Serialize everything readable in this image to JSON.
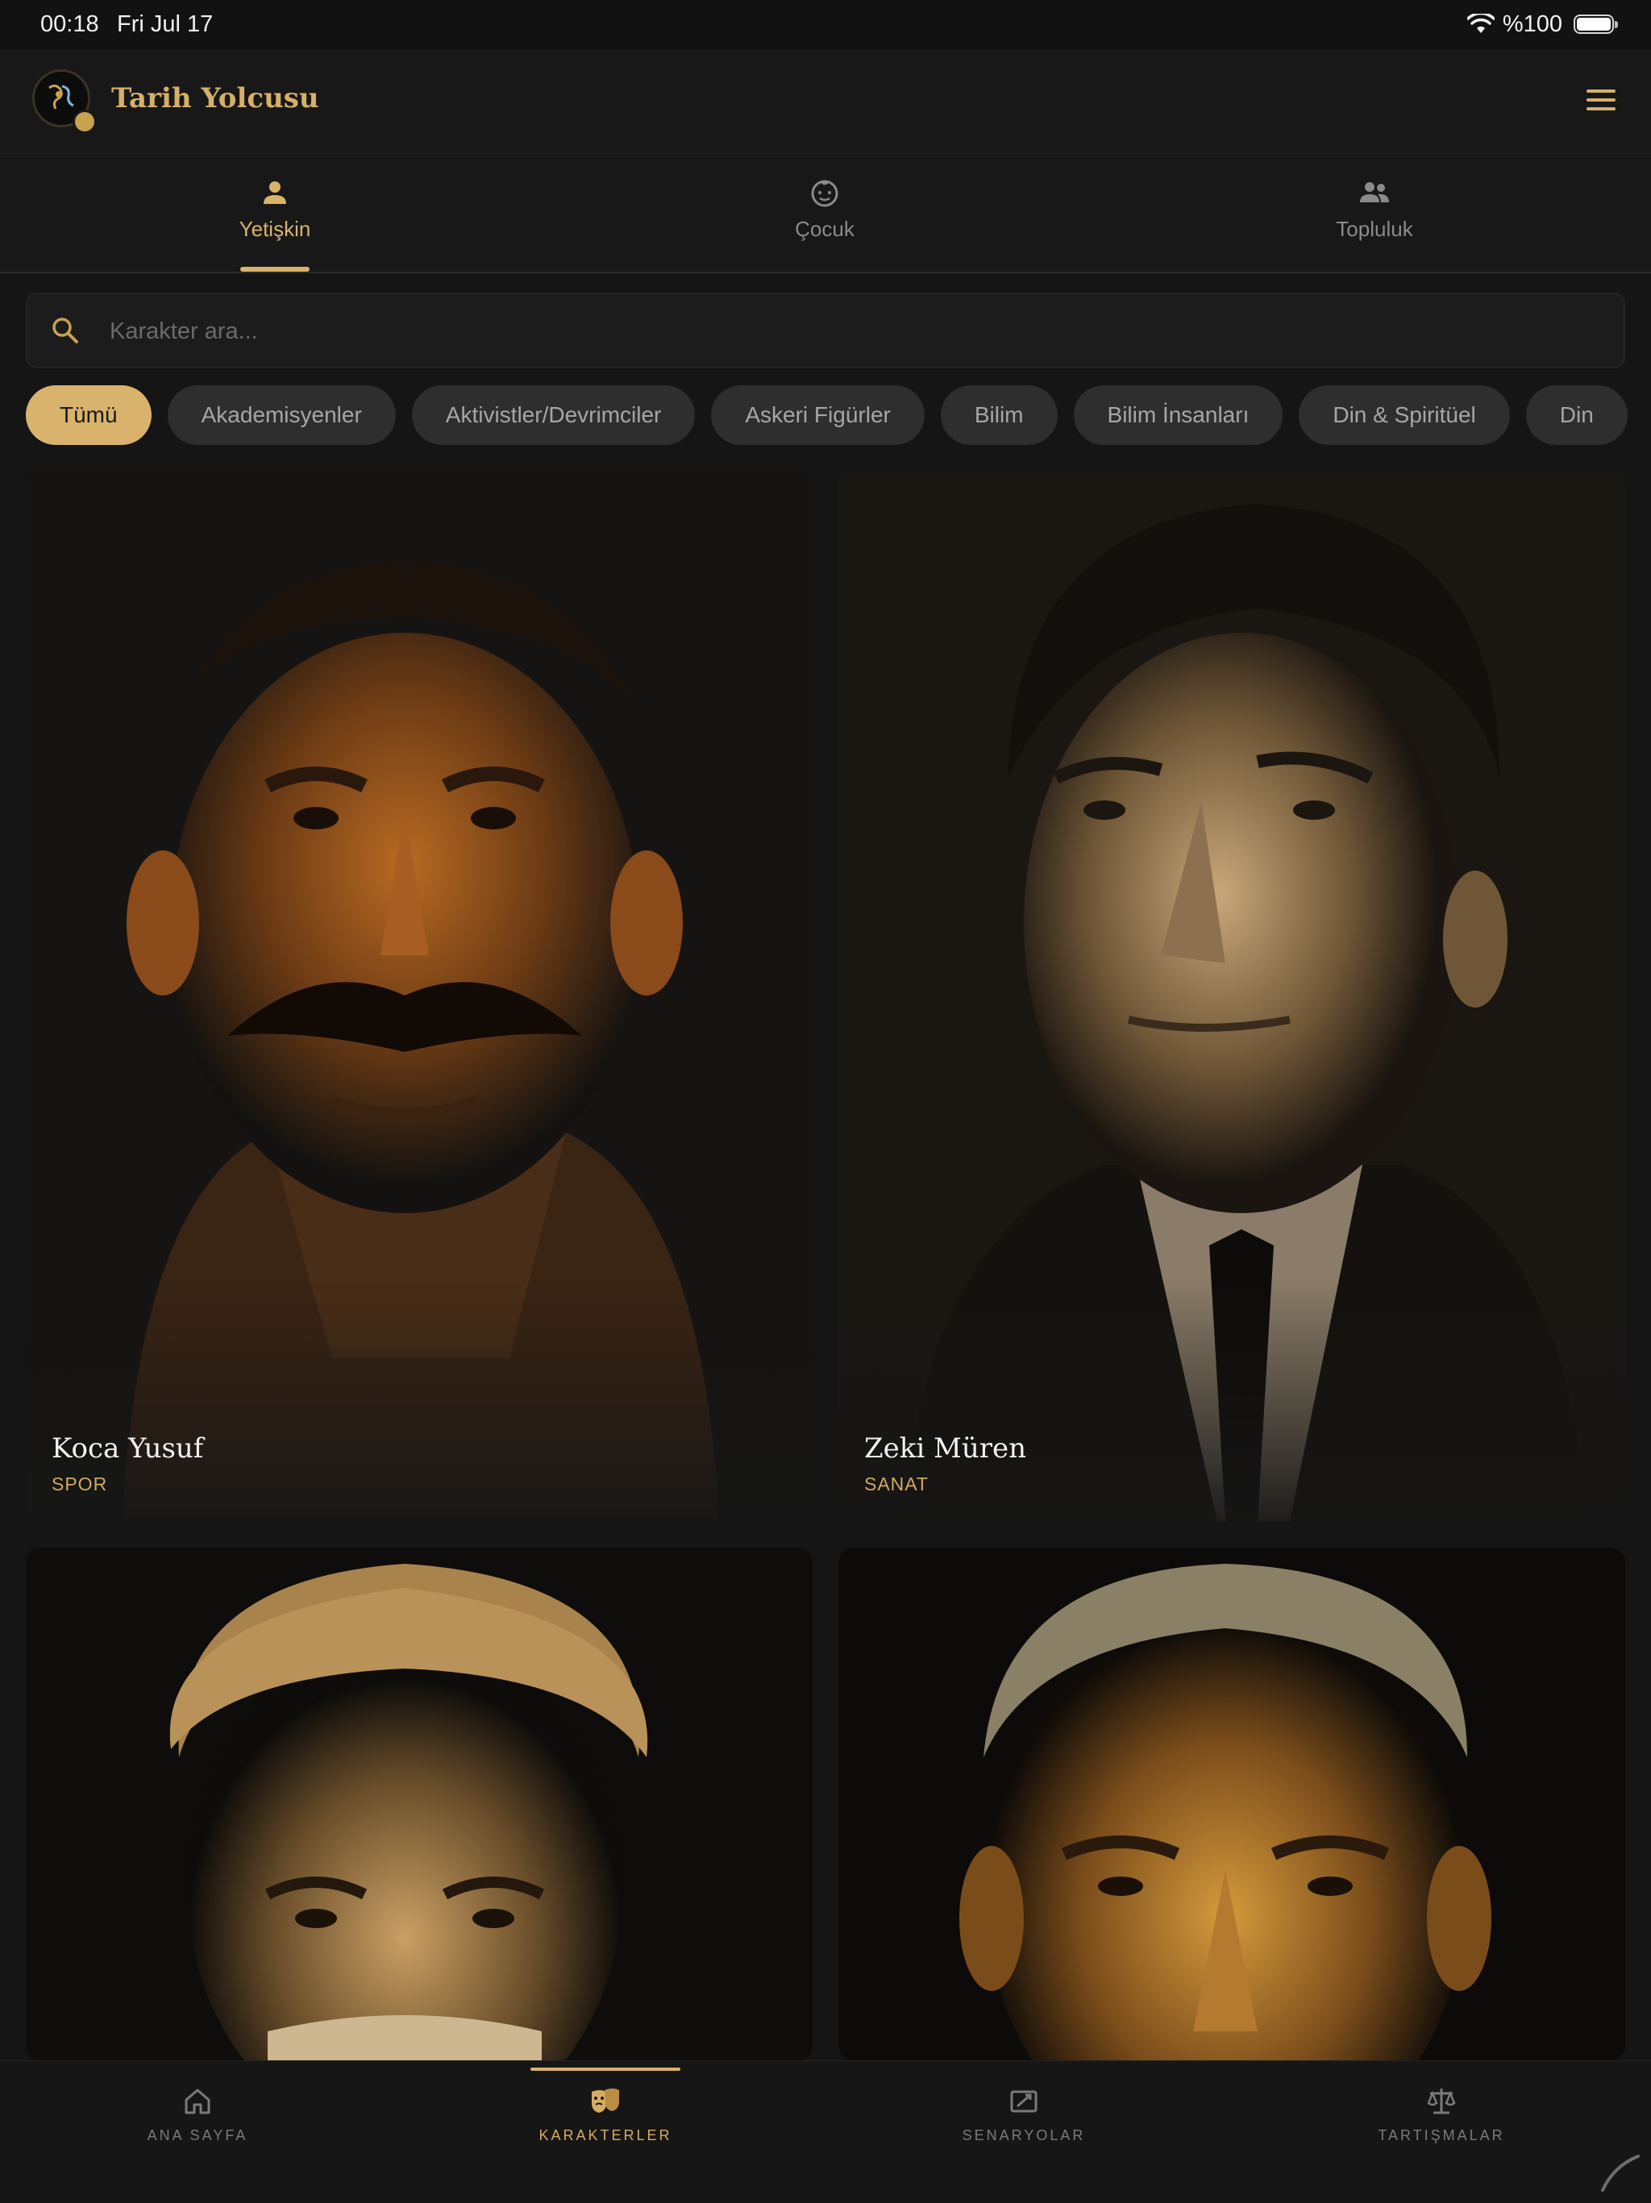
{
  "status_bar": {
    "time": "00:18",
    "date": "Fri Jul 17",
    "battery_text": "%100",
    "icons": [
      "wifi-icon",
      "battery-icon"
    ]
  },
  "header": {
    "app_title": "Tarih Yolcusu",
    "menu_icon": "hamburger-menu-icon"
  },
  "tabs": [
    {
      "label": "Yetişkin",
      "icon": "person-icon",
      "active": true
    },
    {
      "label": "Çocuk",
      "icon": "child-face-icon",
      "active": false
    },
    {
      "label": "Topluluk",
      "icon": "group-icon",
      "active": false
    }
  ],
  "search": {
    "placeholder": "Karakter ara...",
    "value": ""
  },
  "filters": [
    {
      "label": "Tümü",
      "active": true
    },
    {
      "label": "Akademisyenler"
    },
    {
      "label": "Aktivistler/Devrimciler"
    },
    {
      "label": "Askeri Figürler"
    },
    {
      "label": "Bilim"
    },
    {
      "label": "Bilim İnsanları"
    },
    {
      "label": "Din & Spiritüel"
    },
    {
      "label": "Din"
    }
  ],
  "characters": [
    {
      "name": "Koca Yusuf",
      "category": "SPOR"
    },
    {
      "name": "Zeki Müren",
      "category": "SANAT"
    },
    {
      "name": "",
      "category": ""
    },
    {
      "name": "",
      "category": ""
    }
  ],
  "bottom_nav": [
    {
      "label": "ANA SAYFA",
      "icon": "home-icon"
    },
    {
      "label": "KARAKTERLER",
      "icon": "theater-masks-icon",
      "active": true
    },
    {
      "label": "SENARYOLAR",
      "icon": "script-icon"
    },
    {
      "label": "TARTIŞMALAR",
      "icon": "scales-icon"
    }
  ],
  "colors": {
    "accent": "#d9b36b",
    "background": "#151515",
    "chip_bg": "#2e2e2e",
    "text_muted": "#8a8a8a"
  }
}
